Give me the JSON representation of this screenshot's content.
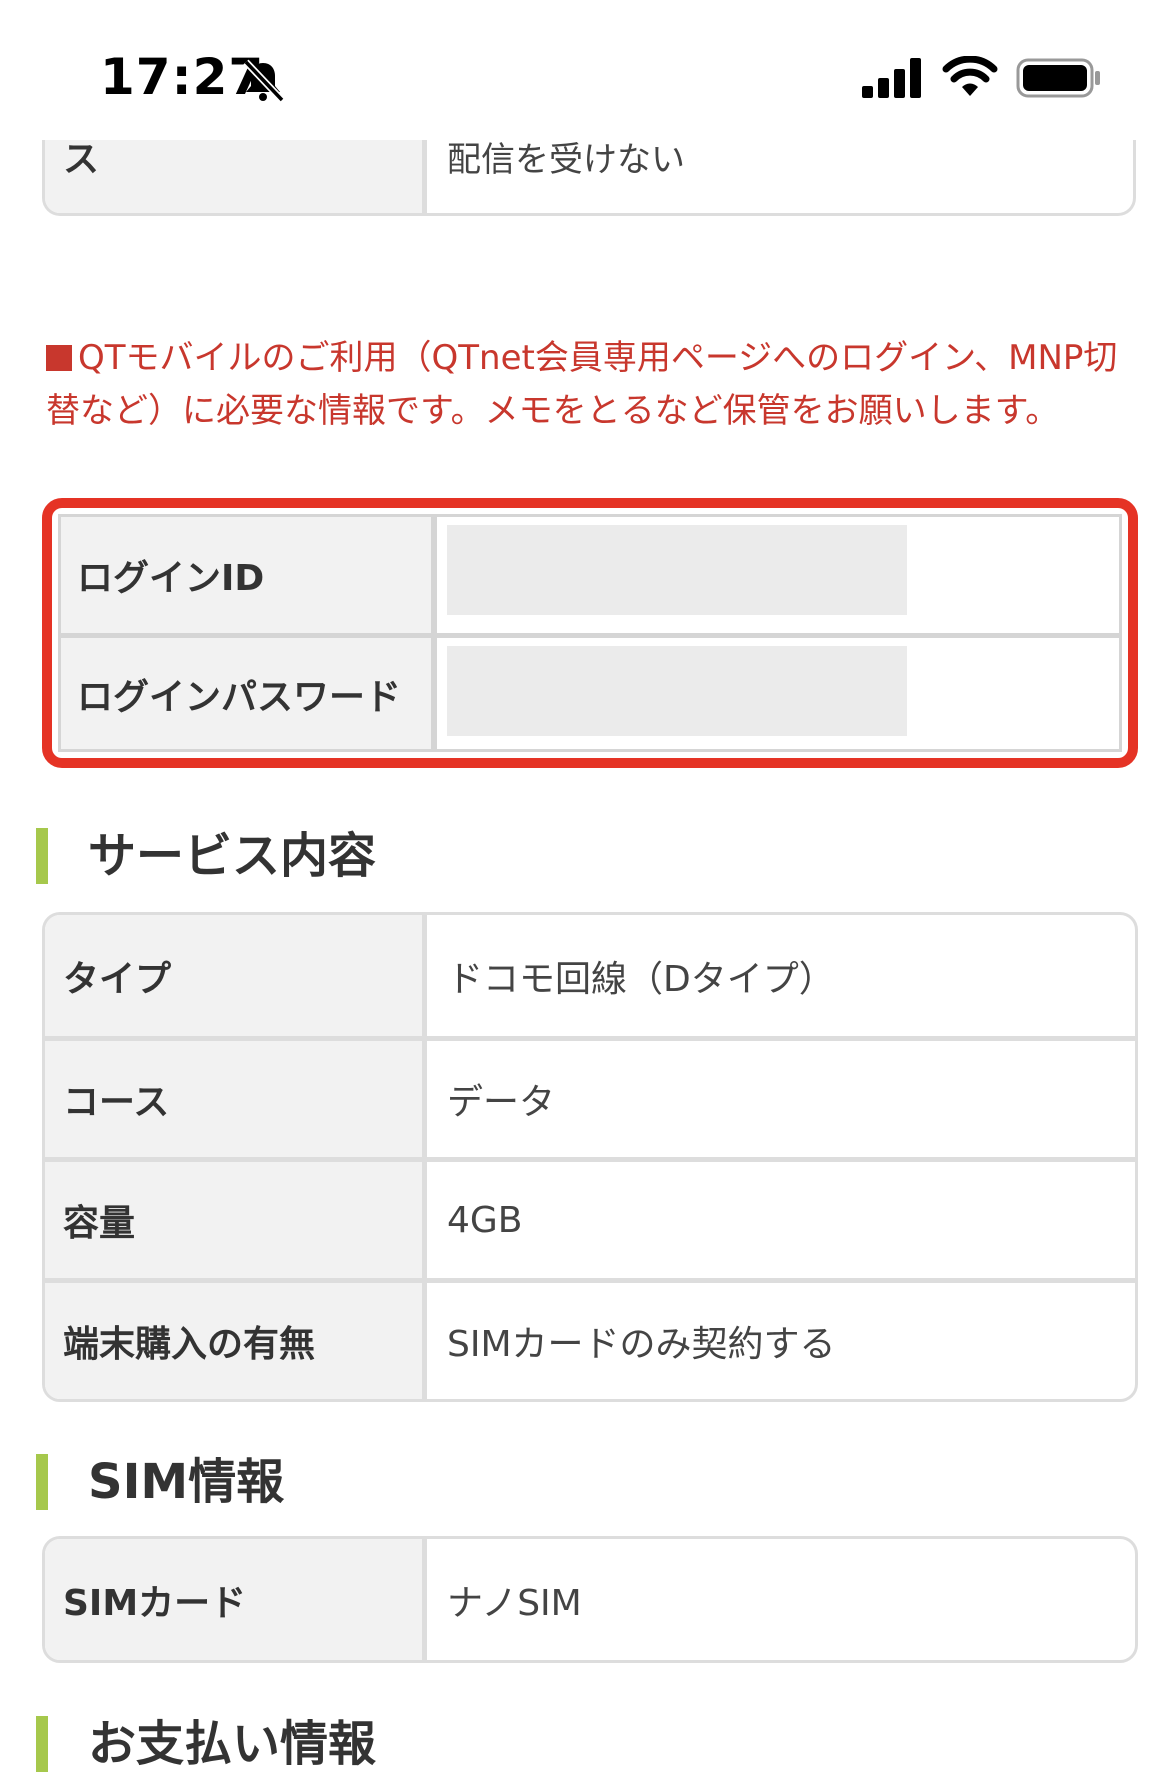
{
  "status_bar": {
    "time": "17:27",
    "icons": [
      "bell-slash-icon",
      "cellular-signal-icon",
      "wifi-icon",
      "battery-icon"
    ]
  },
  "top_table": {
    "label": "ス",
    "value": "配信を受けない"
  },
  "notice": {
    "text": "QTモバイルのご利用（QTnet会員専用ページへのログイン、MNP切替など）に必要な情報です。メモをとるなど保管をお願いします。",
    "color": "#c8372d"
  },
  "login": {
    "outline_color": "#e53325",
    "rows": [
      {
        "label": "ログインID",
        "value": ""
      },
      {
        "label": "ログインパスワード",
        "value": ""
      }
    ]
  },
  "sections": {
    "service": {
      "heading": "サービス内容",
      "rows": [
        {
          "label": "タイプ",
          "value": "ドコモ回線（Dタイプ）"
        },
        {
          "label": "コース",
          "value": "データ"
        },
        {
          "label": "容量",
          "value": "4GB"
        },
        {
          "label": "端末購入の有無",
          "value": "SIMカードのみ契約する"
        }
      ]
    },
    "sim": {
      "heading": "SIM情報",
      "rows": [
        {
          "label": "SIMカード",
          "value": "ナノSIM"
        }
      ]
    },
    "payment": {
      "heading": "お支払い情報"
    }
  },
  "colors": {
    "heading_accent": "#a6c84c",
    "table_border": "#dddddd",
    "label_bg": "#f2f2f2"
  }
}
